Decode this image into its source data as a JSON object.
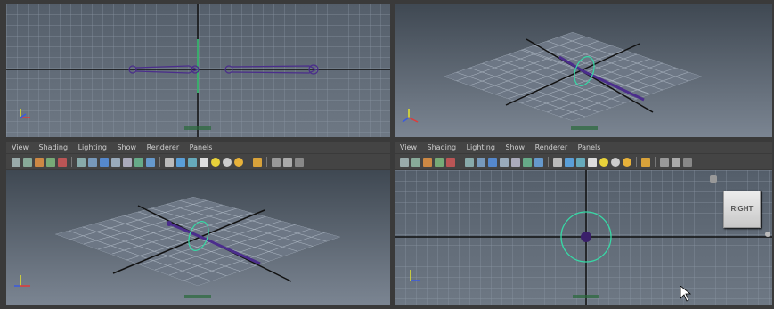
{
  "menus": {
    "left": [
      "View",
      "Shading",
      "Lighting",
      "Show",
      "Renderer",
      "Panels"
    ],
    "right": [
      "View",
      "Shading",
      "Lighting",
      "Show",
      "Renderer",
      "Panels"
    ]
  },
  "viewcube": {
    "label": "RIGHT"
  },
  "axes": {
    "x": "x",
    "y": "y",
    "z": "z"
  },
  "colors": {
    "grid": "#8c98a6",
    "bone": "#4b2d8c",
    "control_circle": "#37d9a6",
    "panel_border": "#1a1a1a"
  }
}
